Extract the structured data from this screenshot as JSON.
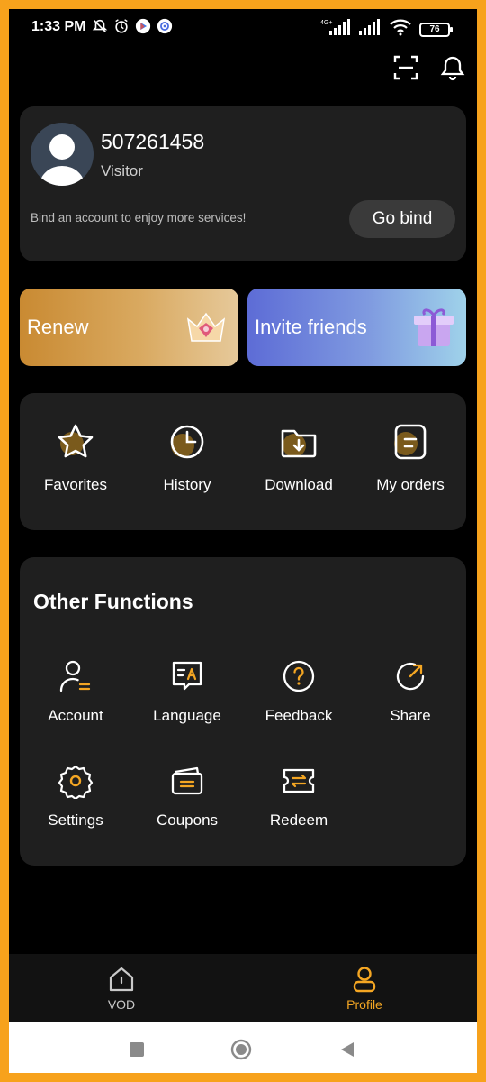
{
  "status_bar": {
    "time": "1:33 PM",
    "network": "4G+",
    "battery": "76"
  },
  "profile": {
    "user_id": "507261458",
    "role": "Visitor",
    "bind_hint": "Bind an account to enjoy more services!",
    "bind_button": "Go bind"
  },
  "promos": {
    "renew": "Renew",
    "invite": "Invite friends"
  },
  "quick_actions": [
    {
      "label": "Favorites",
      "icon": "star-icon"
    },
    {
      "label": "History",
      "icon": "clock-icon"
    },
    {
      "label": "Download",
      "icon": "download-folder-icon"
    },
    {
      "label": "My orders",
      "icon": "orders-icon"
    }
  ],
  "other_functions": {
    "title": "Other Functions",
    "items": [
      {
        "label": "Account",
        "icon": "account-icon"
      },
      {
        "label": "Language",
        "icon": "language-icon"
      },
      {
        "label": "Feedback",
        "icon": "feedback-icon"
      },
      {
        "label": "Share",
        "icon": "share-icon"
      },
      {
        "label": "Settings",
        "icon": "gear-icon"
      },
      {
        "label": "Coupons",
        "icon": "coupon-icon"
      },
      {
        "label": "Redeem",
        "icon": "redeem-icon"
      }
    ]
  },
  "bottom_nav": {
    "vod": "VOD",
    "profile": "Profile"
  },
  "colors": {
    "accent": "#f4a623",
    "card": "#1f1f1f",
    "background": "#000000"
  }
}
